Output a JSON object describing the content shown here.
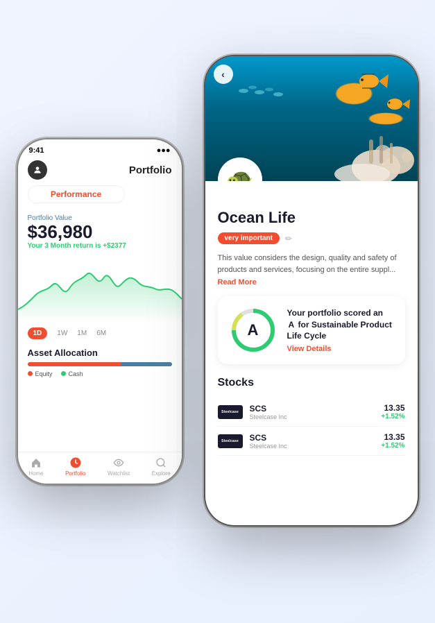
{
  "left_phone": {
    "status_bar": {
      "time": "9:41"
    },
    "header": {
      "title": "Portfolio",
      "avatar_icon": "👤"
    },
    "performance_button": "Performance",
    "portfolio": {
      "label": "Portfolio Value",
      "amount": "$36,980",
      "return_text": "Your 3 Month return is",
      "return_value": "+$2377"
    },
    "time_filters": [
      "1D",
      "1W",
      "1M",
      "6M"
    ],
    "active_filter": "1D",
    "asset_allocation": {
      "title": "Asset Allocation",
      "legend": [
        {
          "label": "Equity",
          "color": "#f04e30"
        },
        {
          "label": "Cash",
          "color": "#2ecc71"
        }
      ]
    },
    "nav_items": [
      {
        "label": "Home",
        "icon": "🏠",
        "active": false
      },
      {
        "label": "Portfolio",
        "icon": "📊",
        "active": true
      },
      {
        "label": "Watchlist",
        "icon": "👁",
        "active": false
      },
      {
        "label": "Explore",
        "icon": "🔍",
        "active": false
      }
    ]
  },
  "right_phone": {
    "back_button": "‹",
    "hero_emoji": "🐢",
    "title": "Ocean Life",
    "importance_tag": "very important",
    "edit_icon": "✏",
    "description": "This value considers the design, quality and safety of products and services, focusing on the entire suppl...",
    "read_more": "Read More",
    "score_card": {
      "grade": "A",
      "description_prefix": "Your portfolio scored an",
      "grade_letter": "A",
      "description_suffix": "for Sustainable Product Life Cycle",
      "view_details": "View Details",
      "donut_segments": [
        {
          "color": "#2ecc71",
          "percent": 75
        },
        {
          "color": "#d4e157",
          "percent": 15
        },
        {
          "color": "#e0e0e0",
          "percent": 10
        }
      ]
    },
    "stocks_section": {
      "title": "Stocks",
      "items": [
        {
          "logo": "Steelcase",
          "ticker": "SCS",
          "name": "Steelcase Inc",
          "price": "13.35",
          "change": "1.52%"
        },
        {
          "logo": "Steelcase",
          "ticker": "SCS",
          "name": "Steelcase Inc",
          "price": "13.35",
          "change": "1.52%"
        }
      ]
    }
  }
}
